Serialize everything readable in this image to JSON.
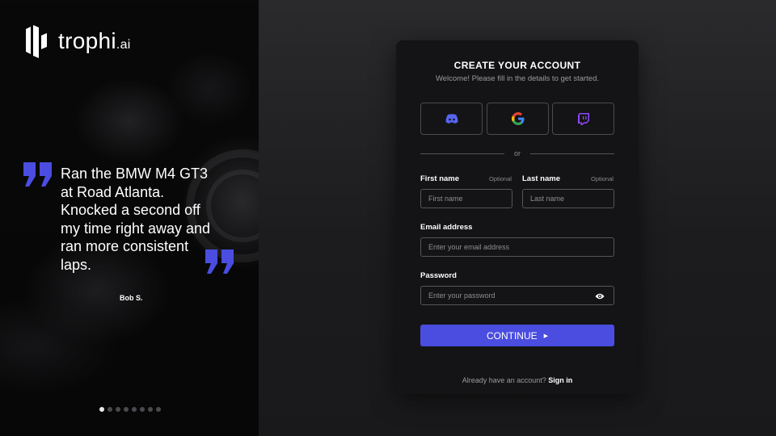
{
  "brand": {
    "name": "trophi",
    "suffix": ".ai"
  },
  "testimonial": {
    "text": "Ran the BMW M4 GT3 at Road Atlanta. Knocked a second off my time right away and ran more consistent laps.",
    "author": "Bob S.",
    "slide_count": 8,
    "active_slide": 1
  },
  "form": {
    "title": "CREATE YOUR ACCOUNT",
    "subtitle": "Welcome! Please fill in the details to get started.",
    "social_icons": [
      "discord-icon",
      "google-icon",
      "twitch-icon"
    ],
    "divider_text": "or",
    "first_name": {
      "label": "First name",
      "optional": "Optional",
      "placeholder": "First name"
    },
    "last_name": {
      "label": "Last name",
      "optional": "Optional",
      "placeholder": "Last name"
    },
    "email": {
      "label": "Email address",
      "placeholder": "Enter your email address"
    },
    "password": {
      "label": "Password",
      "placeholder": "Enter your password"
    },
    "continue_label": "CONTINUE",
    "footer_text": "Already have an account?",
    "signin_label": "Sign in"
  },
  "colors": {
    "accent": "#4a4de0",
    "quote_marks": "#4a4de0",
    "card": "#141416"
  }
}
